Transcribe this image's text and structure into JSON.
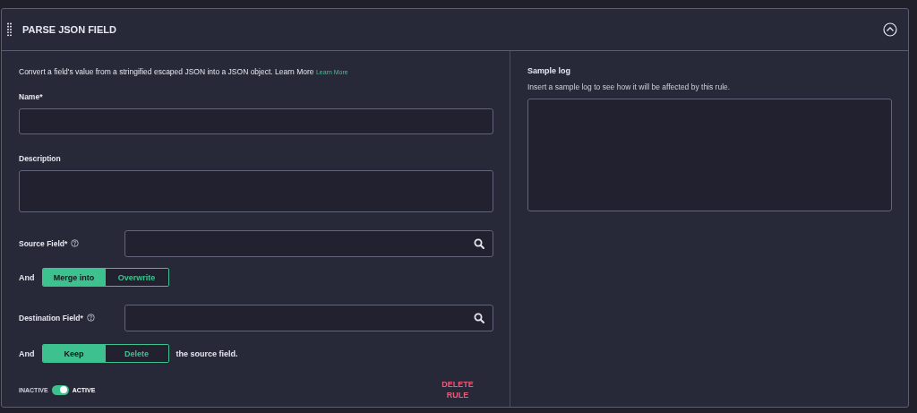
{
  "panel": {
    "title": "PARSE JSON FIELD",
    "expanded": true
  },
  "form": {
    "intro": "Convert a field's value from a stringified escaped JSON into a JSON object. Learn More",
    "learn_more": "Learn More",
    "rows": [
      {
        "kind": "text",
        "label": "Name*"
      },
      {
        "kind": "textarea",
        "label": "Description"
      },
      {
        "kind": "search",
        "label": "Source Field*",
        "help": true
      },
      {
        "kind": "choice",
        "prefix": "And",
        "options": [
          {
            "label": "Merge into",
            "selected": true
          },
          {
            "label": "Overwrite",
            "selected": false
          }
        ]
      },
      {
        "kind": "search",
        "label": "Destination Field*",
        "help": true
      },
      {
        "kind": "choice",
        "prefix": "And",
        "options": [
          {
            "label": "Keep",
            "selected": true
          },
          {
            "label": "Delete",
            "selected": false
          }
        ],
        "suffix": "the source field."
      }
    ],
    "status": {
      "off_label": "INACTIVE",
      "on_label": "ACTIVE",
      "on": true
    },
    "delete_button": "DELETE RULE"
  },
  "sample": {
    "title": "Sample log",
    "hint": "Insert a sample log to see how it will be affected by this rule."
  }
}
